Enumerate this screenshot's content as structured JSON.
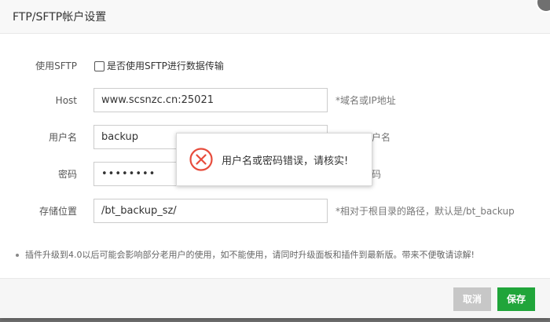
{
  "dialog": {
    "title": "FTP/SFTP帐户设置"
  },
  "form": {
    "sftp": {
      "label": "使用SFTP",
      "checkbox_text": "是否使用SFTP进行数据传输",
      "checked": false
    },
    "host": {
      "label": "Host",
      "value": "www.scsnzc.cn:25021",
      "hint": "*域名或IP地址"
    },
    "username": {
      "label": "用户名",
      "value": "backup",
      "hint": "户名"
    },
    "password": {
      "label": "密码",
      "value": "••••••••",
      "hint": "码"
    },
    "path": {
      "label": "存储位置",
      "value": "/bt_backup_sz/",
      "hint": "*相对于根目录的路径，默认是/bt_backup"
    }
  },
  "notice": "插件升级到4.0以后可能会影响部分老用户的使用，如不能使用，请同时升级面板和插件到最新版。带来不便敬请谅解!",
  "footer": {
    "cancel_label": "取消",
    "save_label": "保存"
  },
  "toast": {
    "message": "用户名或密码错误，请核实!",
    "icon": "error-x-circle-icon"
  },
  "colors": {
    "primary": "#20a53a",
    "error": "#e74c3c",
    "disabled": "#c7c7c7"
  }
}
